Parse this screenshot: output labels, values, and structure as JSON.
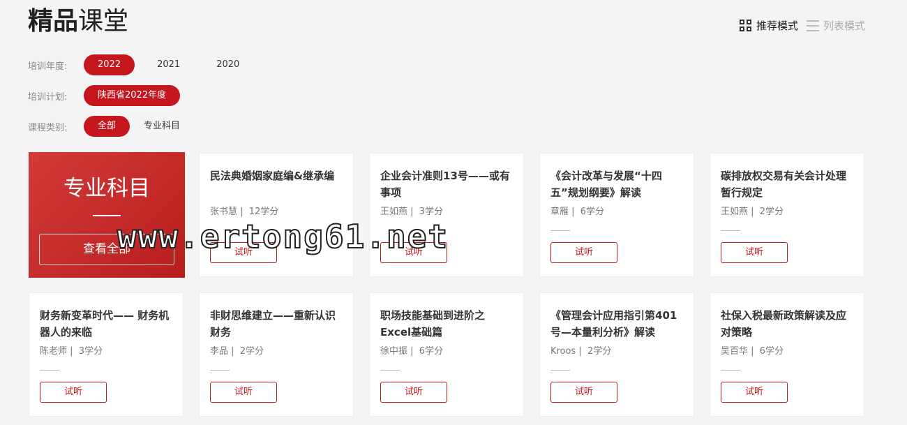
{
  "header": {
    "title_bold": "精品",
    "title_light": "课堂",
    "modes": [
      {
        "label": "推荐模式",
        "icon": "grid-icon",
        "active": true
      },
      {
        "label": "列表模式",
        "icon": "list-icon",
        "active": false
      }
    ]
  },
  "filters": {
    "year": {
      "label": "培训年度:",
      "options": [
        "2022",
        "2021",
        "2020"
      ],
      "selected": "2022"
    },
    "plan": {
      "label": "培训计划:",
      "options": [
        "陕西省2022年度"
      ],
      "selected": "陕西省2022年度"
    },
    "category": {
      "label": "课程类别:",
      "options": [
        "全部",
        "专业科目"
      ],
      "selected": "全部"
    }
  },
  "feature": {
    "title": "专业科目",
    "button": "查看全部"
  },
  "trial_label": "试听",
  "courses": [
    {
      "title": "民法典婚姻家庭编&继承编",
      "teacher": "张书慧",
      "credits": "12学分"
    },
    {
      "title": "企业会计准则13号——或有事项",
      "teacher": "王如燕",
      "credits": "3学分"
    },
    {
      "title": "《会计改革与发展“十四五”规划纲要》解读",
      "teacher": "章雁",
      "credits": "6学分"
    },
    {
      "title": "碳排放权交易有关会计处理暂行规定",
      "teacher": "王如燕",
      "credits": "2学分"
    },
    {
      "title": "财务新变革时代—— 财务机器人的来临",
      "teacher": "陈老师",
      "credits": "3学分"
    },
    {
      "title": "非财思维建立——重新认识财务",
      "teacher": "李品",
      "credits": "2学分"
    },
    {
      "title": "职场技能基础到进阶之Excel基础篇",
      "teacher": "徐中振",
      "credits": "6学分"
    },
    {
      "title": "《管理会计应用指引第401号—本量利分析》解读",
      "teacher": "Kroos",
      "credits": "2学分"
    },
    {
      "title": "社保入税最新政策解读及应对策略",
      "teacher": "吴百华",
      "credits": "6学分"
    }
  ],
  "watermark": "www.ertong61.net"
}
